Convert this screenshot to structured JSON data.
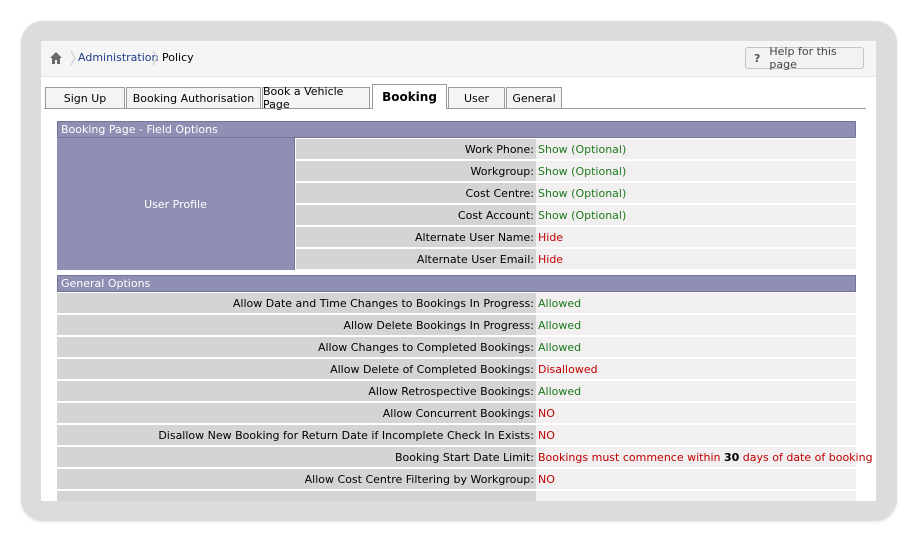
{
  "breadcrumb": {
    "items": [
      {
        "label": "Administration"
      },
      {
        "label": "Policy"
      }
    ]
  },
  "help_button": {
    "icon": "?",
    "label": "Help for this page"
  },
  "tabs": [
    {
      "label": "Sign Up"
    },
    {
      "label": "Booking Authorisation"
    },
    {
      "label": "Book a Vehicle Page"
    },
    {
      "label": "Booking",
      "active": true
    },
    {
      "label": "User"
    },
    {
      "label": "General"
    }
  ],
  "booking_fields": {
    "title": "Booking Page - Field Options",
    "group_label": "User Profile",
    "rows": [
      {
        "label": "Work Phone:",
        "value": "Show (Optional)",
        "status": "green"
      },
      {
        "label": "Workgroup:",
        "value": "Show (Optional)",
        "status": "green"
      },
      {
        "label": "Cost Centre:",
        "value": "Show (Optional)",
        "status": "green"
      },
      {
        "label": "Cost Account:",
        "value": "Show (Optional)",
        "status": "green"
      },
      {
        "label": "Alternate User Name:",
        "value": "Hide",
        "status": "red"
      },
      {
        "label": "Alternate User Email:",
        "value": "Hide",
        "status": "red"
      }
    ]
  },
  "general_options": {
    "title": "General Options",
    "rows": [
      {
        "label": "Allow Date and Time Changes to Bookings In Progress:",
        "value": "Allowed",
        "status": "green"
      },
      {
        "label": "Allow Delete Bookings In Progress:",
        "value": "Allowed",
        "status": "green"
      },
      {
        "label": "Allow Changes to Completed Bookings:",
        "value": "Allowed",
        "status": "green"
      },
      {
        "label": "Allow Delete of Completed Bookings:",
        "value": "Disallowed",
        "status": "red"
      },
      {
        "label": "Allow Retrospective Bookings:",
        "value": "Allowed",
        "status": "green"
      },
      {
        "label": "Allow Concurrent Bookings:",
        "value": "NO",
        "status": "red"
      },
      {
        "label": "Disallow New Booking for Return Date if Incomplete Check In Exists:",
        "value": "NO",
        "status": "red"
      },
      {
        "label": "Booking Start Date Limit:",
        "value_prefix": "Bookings must commence within ",
        "value_bold": "30",
        "value_suffix": " days of date of booking",
        "status": "red"
      },
      {
        "label": "Allow Cost Centre Filtering by Workgroup:",
        "value": "NO",
        "status": "red"
      }
    ]
  },
  "colors": {
    "section_header": "#8f8fb4",
    "allowed": "#1e7a1e",
    "disallowed": "#c00000"
  }
}
